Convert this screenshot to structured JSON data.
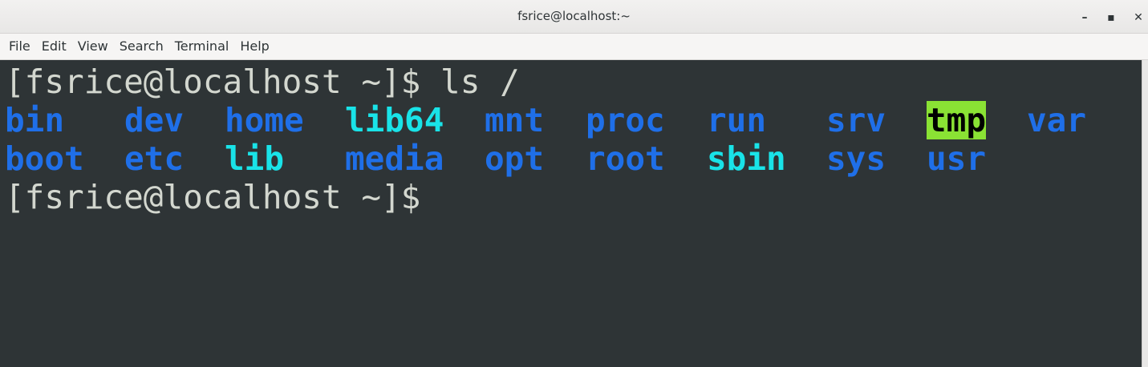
{
  "window": {
    "title": "fsrice@localhost:~",
    "minimize_icon": "minimize-icon",
    "maximize_icon": "maximize-icon",
    "close_icon": "close-icon",
    "minimize_glyph": "–",
    "maximize_glyph": "▪",
    "close_glyph": "✕"
  },
  "menubar": {
    "items": [
      "File",
      "Edit",
      "View",
      "Search",
      "Terminal",
      "Help"
    ]
  },
  "terminal": {
    "command_line": "[fsrice@localhost ~]$ ls /",
    "prompt_line": "[fsrice@localhost ~]$",
    "row1": [
      "bin",
      "dev",
      "home",
      "lib64",
      "mnt",
      "proc",
      "run",
      "srv",
      "tmp",
      "var"
    ],
    "row2": [
      "boot",
      "etc",
      "lib",
      "media",
      "opt",
      "root",
      "sbin",
      "sys",
      "usr"
    ],
    "colors": {
      "background": "#2e3436",
      "foreground": "#d3d7cf",
      "directory": "#1f6fe8",
      "symlink": "#19e3e8",
      "sticky_bg": "#8ae234"
    }
  }
}
